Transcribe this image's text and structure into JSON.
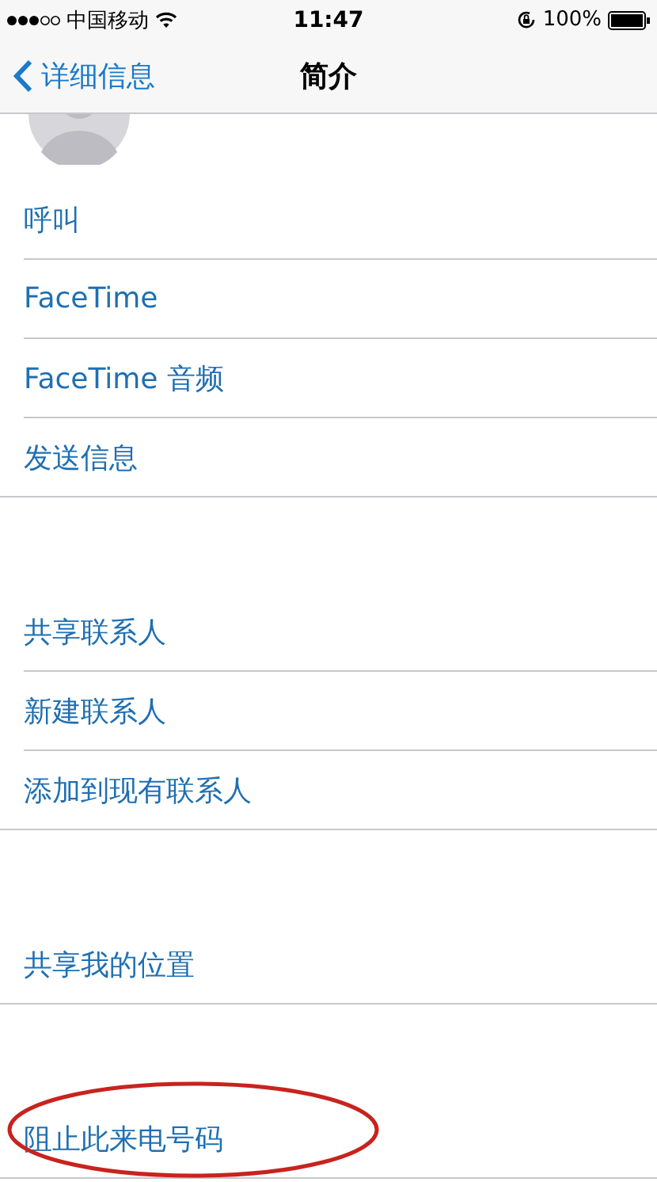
{
  "status_bar": {
    "carrier": "中国移动",
    "time": "11:47",
    "battery": "100%"
  },
  "nav": {
    "back": "详细信息",
    "title": "简介"
  },
  "sections": [
    {
      "rows": [
        {
          "label": "呼叫",
          "circled": false
        },
        {
          "label": "FaceTime",
          "circled": false
        },
        {
          "label": "FaceTime 音频",
          "circled": false
        },
        {
          "label": "发送信息",
          "circled": false
        }
      ]
    },
    {
      "rows": [
        {
          "label": "共享联系人",
          "circled": false
        },
        {
          "label": "新建联系人",
          "circled": false
        },
        {
          "label": "添加到现有联系人",
          "circled": false
        }
      ]
    },
    {
      "rows": [
        {
          "label": "共享我的位置",
          "circled": false
        }
      ]
    },
    {
      "rows": [
        {
          "label": "阻止此来电号码",
          "circled": true
        }
      ]
    }
  ]
}
